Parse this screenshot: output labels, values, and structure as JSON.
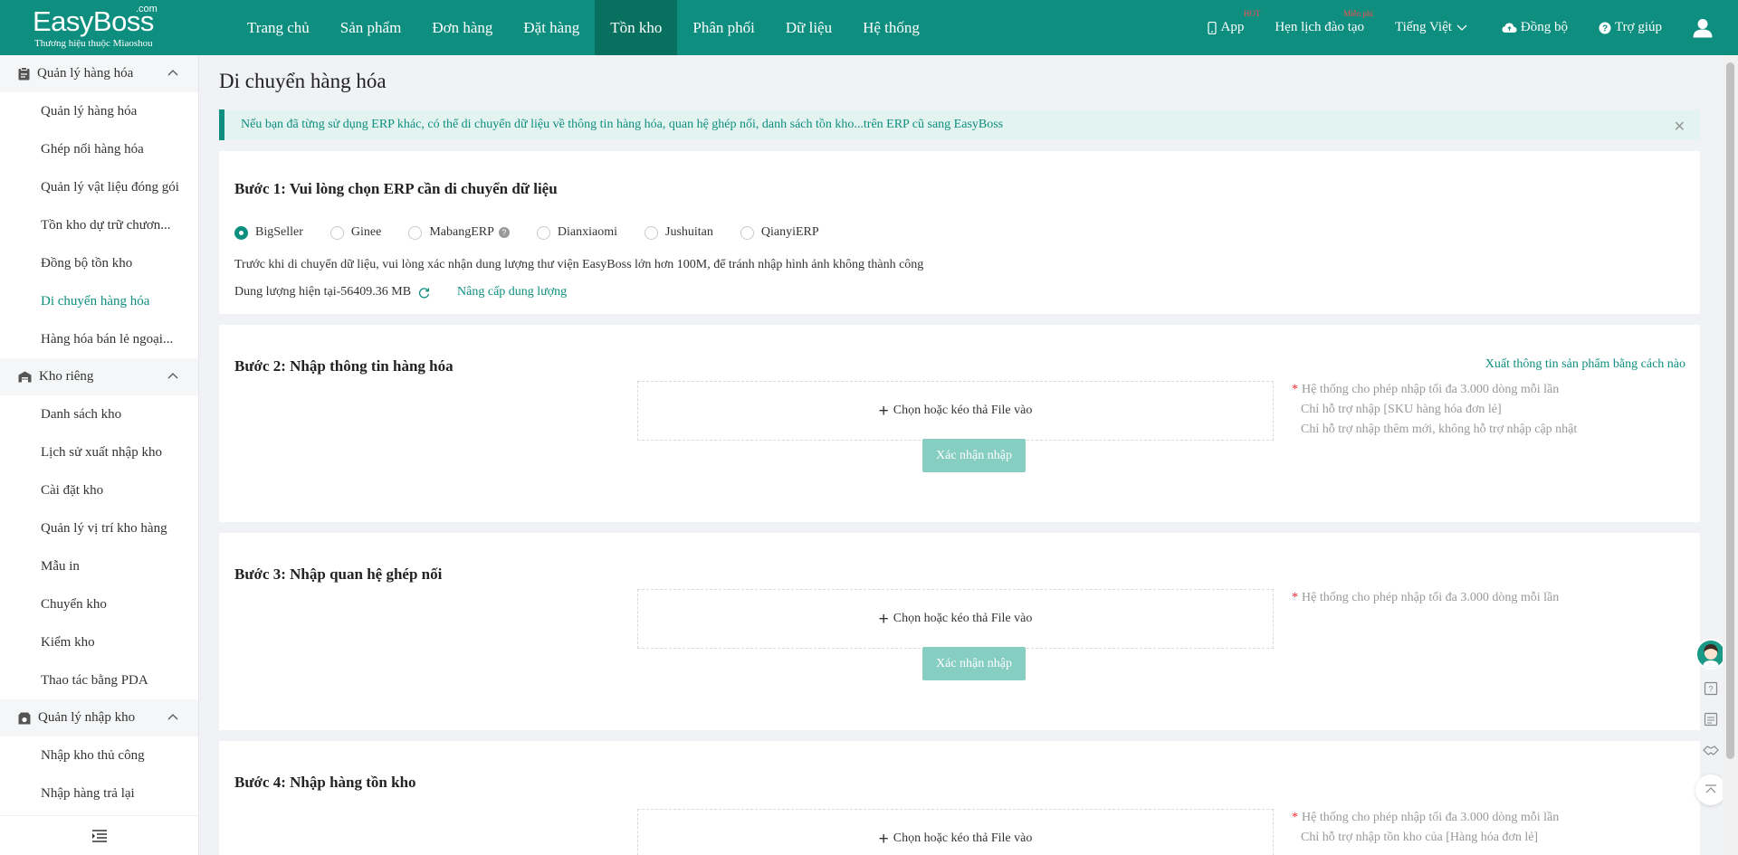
{
  "brand": {
    "name": "EasyBoss",
    "dotcom": ".com",
    "tagline": "Thương hiệu thuộc Miaoshou"
  },
  "nav": [
    "Trang chủ",
    "Sản phẩm",
    "Đơn hàng",
    "Đặt hàng",
    "Tồn kho",
    "Phân phối",
    "Dữ liệu",
    "Hệ thống"
  ],
  "nav_active": "Tồn kho",
  "topright": {
    "app": "App",
    "app_badge": "HOT",
    "training": "Hẹn lịch đào tạo",
    "training_badge": "Miễn phí",
    "language": "Tiếng Việt",
    "sync": "Đồng bộ",
    "help": "Trợ giúp"
  },
  "sidebar": {
    "groups": [
      {
        "label": "Quản lý hàng hóa",
        "icon": "clipboard-icon",
        "items": [
          "Quản lý hàng hóa",
          "Ghép nối hàng hóa",
          "Quản lý vật liệu đóng gói",
          "Tồn kho dự trữ chươn...",
          "Đồng bộ tồn kho",
          "Di chuyển hàng hóa",
          "Hàng hóa bán lẻ ngoại..."
        ]
      },
      {
        "label": "Kho riêng",
        "icon": "warehouse-icon",
        "items": [
          "Danh sách kho",
          "Lịch sử xuất nhập kho",
          "Cài đặt kho",
          "Quản lý vị trí kho hàng",
          "Mẫu in",
          "Chuyển kho",
          "Kiểm kho",
          "Thao tác bằng PDA"
        ]
      },
      {
        "label": "Quản lý nhập kho",
        "icon": "inbound-box-icon",
        "items": [
          "Nhập kho thủ công",
          "Nhập hàng trả lại"
        ]
      }
    ],
    "active_item": "Di chuyển hàng hóa"
  },
  "page": {
    "title": "Di chuyển hàng hóa",
    "notice": "Nếu bạn đã từng sử dụng ERP khác, có thể di chuyển dữ liệu về thông tin hàng hóa, quan hệ ghép nối, danh sách tồn kho...trên ERP cũ sang EasyBoss",
    "step1": {
      "title": "Bước 1: Vui lòng chọn ERP cần di chuyển dữ liệu",
      "options": [
        "BigSeller",
        "Ginee",
        "MabangERP",
        "Dianxiaomi",
        "Jushuitan",
        "QianyiERP"
      ],
      "selected": "BigSeller",
      "note": "Trước khi di chuyển dữ liệu, vui lòng xác nhận dung lượng thư viện EasyBoss lớn hơn 100M, để tránh nhập hình ảnh không thành công",
      "capacity": "Dung lượng hiện tại-56409.36 MB",
      "upgrade": "Nâng cấp dung lượng"
    },
    "step2": {
      "title": "Bước 2: Nhập thông tin hàng hóa",
      "export_link": "Xuất thông tin sản phẩm bằng cách nào",
      "dropzone": "Chọn hoặc kéo thả File vào",
      "confirm": "Xác nhận nhập",
      "hints": [
        "Hệ thống cho phép nhập tối đa 3.000 dòng mỗi lần",
        "Chỉ hỗ trợ nhập [SKU hàng hóa đơn lẻ]",
        "Chỉ hỗ trợ nhập thêm mới, không hỗ trợ nhập cập nhật"
      ]
    },
    "step3": {
      "title": "Bước 3: Nhập quan hệ ghép nối",
      "dropzone": "Chọn hoặc kéo thả File vào",
      "confirm": "Xác nhận nhập",
      "hints": [
        "Hệ thống cho phép nhập tối đa 3.000 dòng mỗi lần"
      ]
    },
    "step4": {
      "title": "Bước 4: Nhập hàng tồn kho",
      "dropzone": "Chọn hoặc kéo thả File vào",
      "hints": [
        "Hệ thống cho phép nhập tối đa 3.000 dòng mỗi lần",
        "Chỉ hỗ trợ nhập tồn kho của [Hàng hóa đơn lẻ]"
      ]
    }
  },
  "colors": {
    "primary": "#0d8e7f",
    "primary_dark": "#07705f",
    "button_disabled": "#86cdc2",
    "required": "#f5222d",
    "badge": "#ff4d4f"
  }
}
